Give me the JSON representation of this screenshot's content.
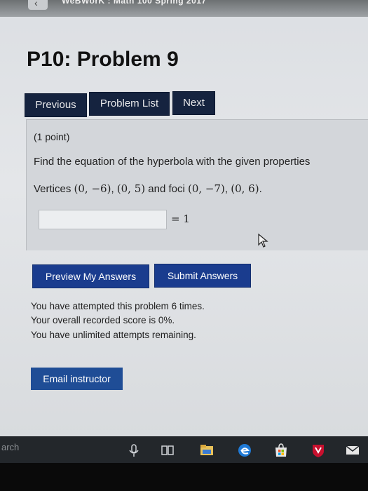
{
  "browser": {
    "tab_title": "WeBWorK : Math 100 Spring 2017"
  },
  "page": {
    "title": "P10: Problem 9"
  },
  "nav": {
    "previous_label": "Previous",
    "problem_list_label": "Problem List",
    "next_label": "Next"
  },
  "problem": {
    "points": "(1 point)",
    "question": "Find the equation of the hyperbola with the given properties",
    "vertices_label": "Vertices",
    "vertex1": "(0, −6)",
    "vertex2": "(0, 5)",
    "and_foci": "and foci",
    "focus1": "(0, −7)",
    "focus2": "(0, 6)",
    "answer_value": "",
    "equals_one": "= 1"
  },
  "actions": {
    "preview_label": "Preview My Answers",
    "submit_label": "Submit Answers"
  },
  "status": {
    "attempts": "You have attempted this problem 6 times.",
    "score": "Your overall recorded score is 0%.",
    "remaining": "You have unlimited attempts remaining."
  },
  "footer": {
    "email_label": "Email instructor"
  },
  "taskbar": {
    "search_text": "arch",
    "icons": [
      "microphone-icon",
      "task-view-icon",
      "file-explorer-icon",
      "edge-browser-icon",
      "store-icon",
      "antivirus-shield-icon",
      "mail-icon"
    ]
  },
  "colors": {
    "nav_button_bg": "#15233f",
    "action_button_bg": "#1a3c8e",
    "page_bg": "#dcdfe3",
    "taskbar_bg": "#23272b"
  }
}
